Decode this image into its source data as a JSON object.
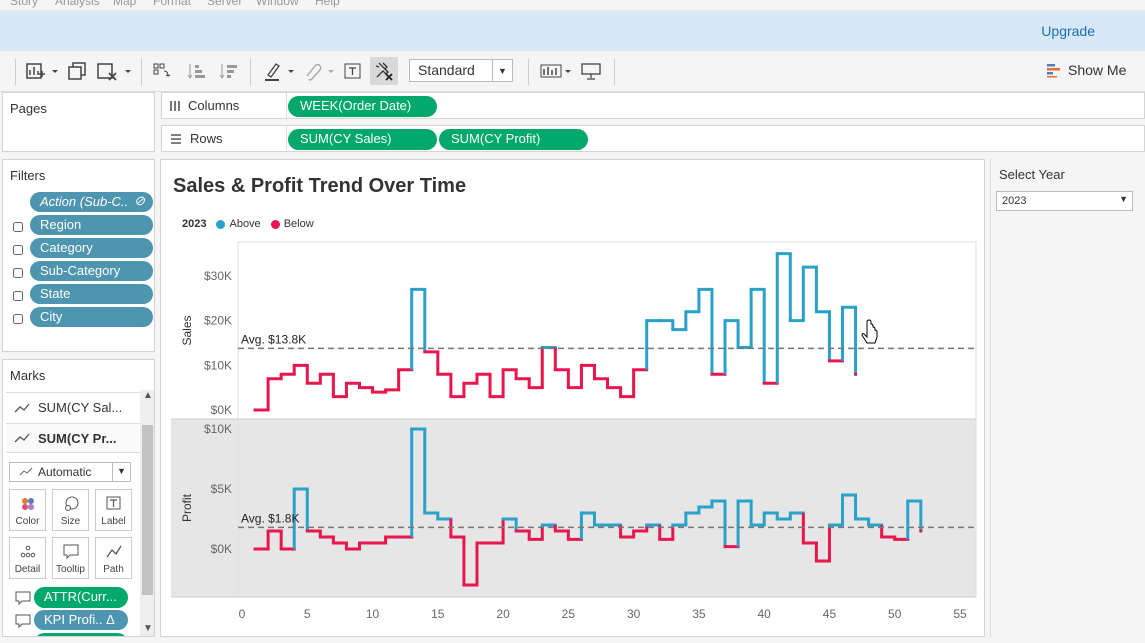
{
  "menu": [
    "Story",
    "Analysis",
    "Map",
    "Format",
    "Server",
    "Window",
    "Help"
  ],
  "upgrade_label": "Upgrade",
  "toolbar": {
    "mark_type_label": "Standard",
    "show_me_label": "Show Me"
  },
  "pages": {
    "title": "Pages"
  },
  "shelves": {
    "columns_label": "Columns",
    "rows_label": "Rows",
    "columns_pills": [
      "WEEK(Order Date)"
    ],
    "rows_pills": [
      "SUM(CY Sales)",
      "SUM(CY Profit)"
    ]
  },
  "filters": {
    "title": "Filters",
    "items": [
      "Action (Sub-C..",
      "Region",
      "Category",
      "Sub-Category",
      "State",
      "City"
    ]
  },
  "marks": {
    "title": "Marks",
    "measures": [
      "SUM(CY Sal...",
      "SUM(CY Pr..."
    ],
    "type_label": "Automatic",
    "buttons": [
      "Color",
      "Size",
      "Label",
      "Detail",
      "Tooltip",
      "Path"
    ],
    "fields": [
      "ATTR(Curr...",
      "KPI Profi.. Δ"
    ]
  },
  "viz": {
    "title": "Sales & Profit Trend Over Time",
    "legend_year": "2023",
    "legend_above": "Above",
    "legend_below": "Below",
    "above_color": "#2aa1c9",
    "below_color": "#e8164d"
  },
  "select_year": {
    "title": "Select Year",
    "value": "2023"
  },
  "chart_data": {
    "type": "line",
    "step": true,
    "x_label": "",
    "x_ticks": [
      0,
      5,
      10,
      15,
      20,
      25,
      30,
      35,
      40,
      45,
      50,
      55
    ],
    "xlim": [
      0,
      55
    ],
    "panes": [
      {
        "name": "Sales",
        "ylabel": "Sales",
        "y_ticks": [
          "$0K",
          "$10K",
          "$20K",
          "$30K"
        ],
        "y_tick_values": [
          0,
          10,
          20,
          30
        ],
        "ylim": [
          -1,
          36
        ],
        "avg": 13.8,
        "avg_label": "Avg. $13.8K",
        "x": [
          1,
          2,
          3,
          4,
          5,
          6,
          7,
          8,
          9,
          10,
          11,
          12,
          13,
          14,
          15,
          16,
          17,
          18,
          19,
          20,
          21,
          22,
          23,
          24,
          25,
          26,
          27,
          28,
          29,
          30,
          31,
          32,
          33,
          34,
          35,
          36,
          37,
          38,
          39,
          40,
          41,
          42,
          43,
          44,
          45,
          46,
          47,
          48,
          49,
          50,
          51,
          52,
          53
        ],
        "values": [
          0,
          7,
          7.5,
          10,
          7,
          6,
          8,
          2,
          6,
          3,
          5,
          4,
          4,
          4.5,
          9,
          27,
          12,
          7,
          9,
          3,
          6,
          5,
          10,
          7,
          5,
          3,
          6,
          4.5,
          7,
          13.5,
          8,
          15,
          8,
          7,
          11,
          5,
          11,
          13,
          7,
          8,
          3.5,
          11,
          20,
          20.5,
          19,
          17,
          21,
          27,
          8,
          20,
          14,
          17,
          27,
          6,
          20,
          34,
          28,
          21,
          35,
          23,
          11,
          23.5,
          11,
          8
        ],
        "y": [
          0,
          7,
          8,
          10,
          6,
          8,
          3,
          6,
          5,
          4,
          4.5,
          9,
          27,
          13,
          8,
          3,
          6,
          8,
          3,
          9,
          7,
          5,
          14,
          9,
          5,
          10,
          7,
          5,
          3,
          9,
          20,
          20,
          18,
          22,
          27,
          8,
          20,
          14,
          27,
          6,
          35,
          20,
          32,
          22,
          11,
          23,
          8
        ]
      },
      {
        "name": "Profit",
        "ylabel": "Profit",
        "y_ticks": [
          "$0K",
          "$5K",
          "$10K"
        ],
        "y_tick_values": [
          0,
          5,
          10
        ],
        "ylim": [
          -3,
          10
        ],
        "avg": 1.8,
        "avg_label": "Avg. $1.8K",
        "x": [
          1,
          2,
          3,
          4,
          5,
          6,
          7,
          8,
          9,
          10,
          11,
          12,
          13,
          14,
          15,
          16,
          17,
          18,
          19,
          20,
          21,
          22,
          23,
          24,
          25,
          26,
          27,
          28,
          29,
          30,
          31,
          32,
          33,
          34,
          35,
          36,
          37,
          38,
          39,
          40,
          41,
          42,
          43,
          44,
          45,
          46,
          47,
          48,
          49,
          50,
          51,
          52,
          53
        ],
        "y": [
          0,
          1.5,
          0,
          5,
          1.5,
          1,
          0.5,
          0,
          0.5,
          0.5,
          1,
          1,
          10,
          3,
          2.5,
          1,
          -3,
          0.5,
          0.5,
          2.5,
          1.5,
          0.8,
          2,
          1.5,
          0.8,
          3,
          2,
          2,
          1,
          1.5,
          2,
          0.8,
          2,
          3,
          3.5,
          4,
          0.2,
          4,
          2,
          3,
          2.5,
          3,
          0.5,
          -1,
          2,
          4.5,
          2.5,
          2,
          1,
          0.8,
          4,
          1.5
        ]
      }
    ]
  }
}
